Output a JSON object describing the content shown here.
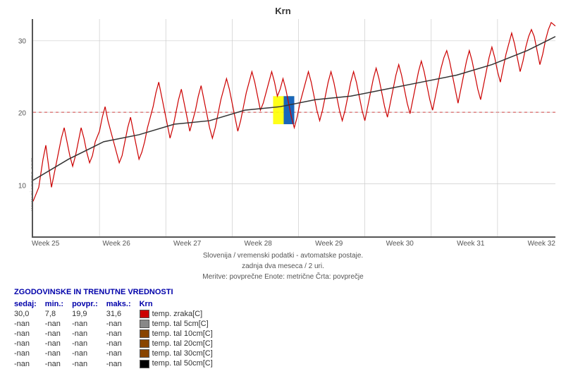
{
  "title": "Krn",
  "watermark": "www.si-vreme.com",
  "subtitle_lines": [
    "Slovenija / vremenski podatki - avtomatske postaje.",
    "zadnja dva meseca / 2 uri.",
    "Meritve: povprečne  Enote: metrične  Črta: povprečje"
  ],
  "legend_title": "ZGODOVINSKE IN TRENUTNE VREDNOSTI",
  "legend_headers": [
    "sedaj:",
    "min.:",
    "povpr.:",
    "maks.:",
    "Krn"
  ],
  "legend_rows": [
    {
      "sedaj": "30,0",
      "min": "7,8",
      "povpr": "19,9",
      "maks": "31,6",
      "label": "temp. zraka[C]",
      "color": "#cc0000"
    },
    {
      "sedaj": "-nan",
      "min": "-nan",
      "povpr": "-nan",
      "maks": "-nan",
      "label": "temp. tal  5cm[C]",
      "color": "#888888"
    },
    {
      "sedaj": "-nan",
      "min": "-nan",
      "povpr": "-nan",
      "maks": "-nan",
      "label": "temp. tal 10cm[C]",
      "color": "#884400"
    },
    {
      "sedaj": "-nan",
      "min": "-nan",
      "povpr": "-nan",
      "maks": "-nan",
      "label": "temp. tal 20cm[C]",
      "color": "#884400"
    },
    {
      "sedaj": "-nan",
      "min": "-nan",
      "povpr": "-nan",
      "maks": "-nan",
      "label": "temp. tal 30cm[C]",
      "color": "#884400"
    },
    {
      "sedaj": "-nan",
      "min": "-nan",
      "povpr": "-nan",
      "maks": "-nan",
      "label": "temp. tal 50cm[C]",
      "color": "#000000"
    }
  ],
  "y_axis": {
    "labels": [
      "30",
      "20",
      "10"
    ],
    "positions_pct": [
      10,
      43,
      76
    ]
  },
  "x_axis": {
    "labels": [
      "Week 25",
      "Week 26",
      "Week 27",
      "Week 28",
      "Week 29",
      "Week 30",
      "Week 31",
      "Week 32"
    ]
  },
  "reference_line_y_pct": 43,
  "colors": {
    "main_line": "#cc0000",
    "avg_line": "#333333",
    "grid": "#cccccc",
    "ref_line": "#cc0000",
    "highlight_yellow": "#ffff00",
    "highlight_blue": "#0055cc"
  }
}
